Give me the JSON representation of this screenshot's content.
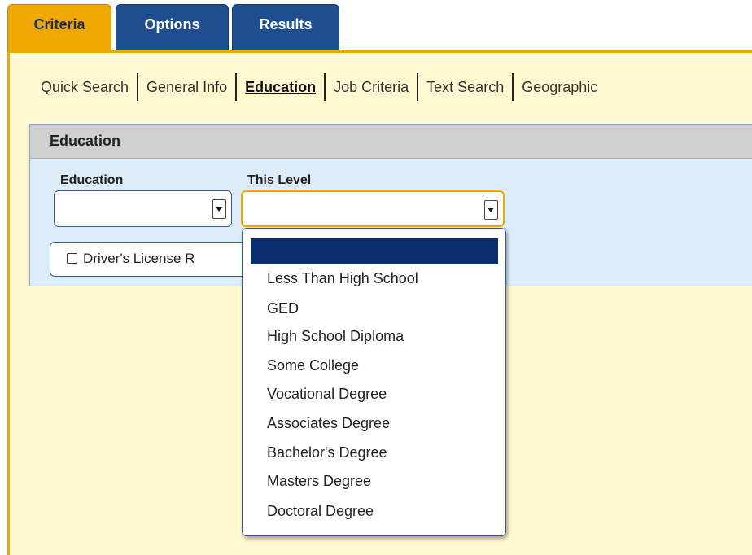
{
  "tabs": [
    {
      "label": "Criteria",
      "active": true
    },
    {
      "label": "Options",
      "active": false
    },
    {
      "label": "Results",
      "active": false
    }
  ],
  "subnav": {
    "items": [
      "Quick Search",
      "General Info",
      "Education",
      "Job Criteria",
      "Text Search",
      "Geographic"
    ],
    "active": "Education"
  },
  "section": {
    "title": "Education",
    "education_label": "Education",
    "education_value": "",
    "this_level_label": "This Level",
    "this_level_value": "",
    "drivers_license_label": "Driver's License R"
  },
  "dropdown": {
    "selected_blank": "",
    "options": [
      "Less Than High School",
      "GED",
      "High School Diploma",
      "Some College",
      "Vocational Degree",
      "Associates Degree",
      "Bachelor's Degree",
      "Masters Degree",
      "Doctoral Degree"
    ]
  },
  "colors": {
    "tab_active": "#f0a800",
    "tab_inactive": "#1f4e8f",
    "panel_bg": "#fff8d0",
    "section_bg": "#dcecf8",
    "highlight": "#0a2d6e"
  }
}
